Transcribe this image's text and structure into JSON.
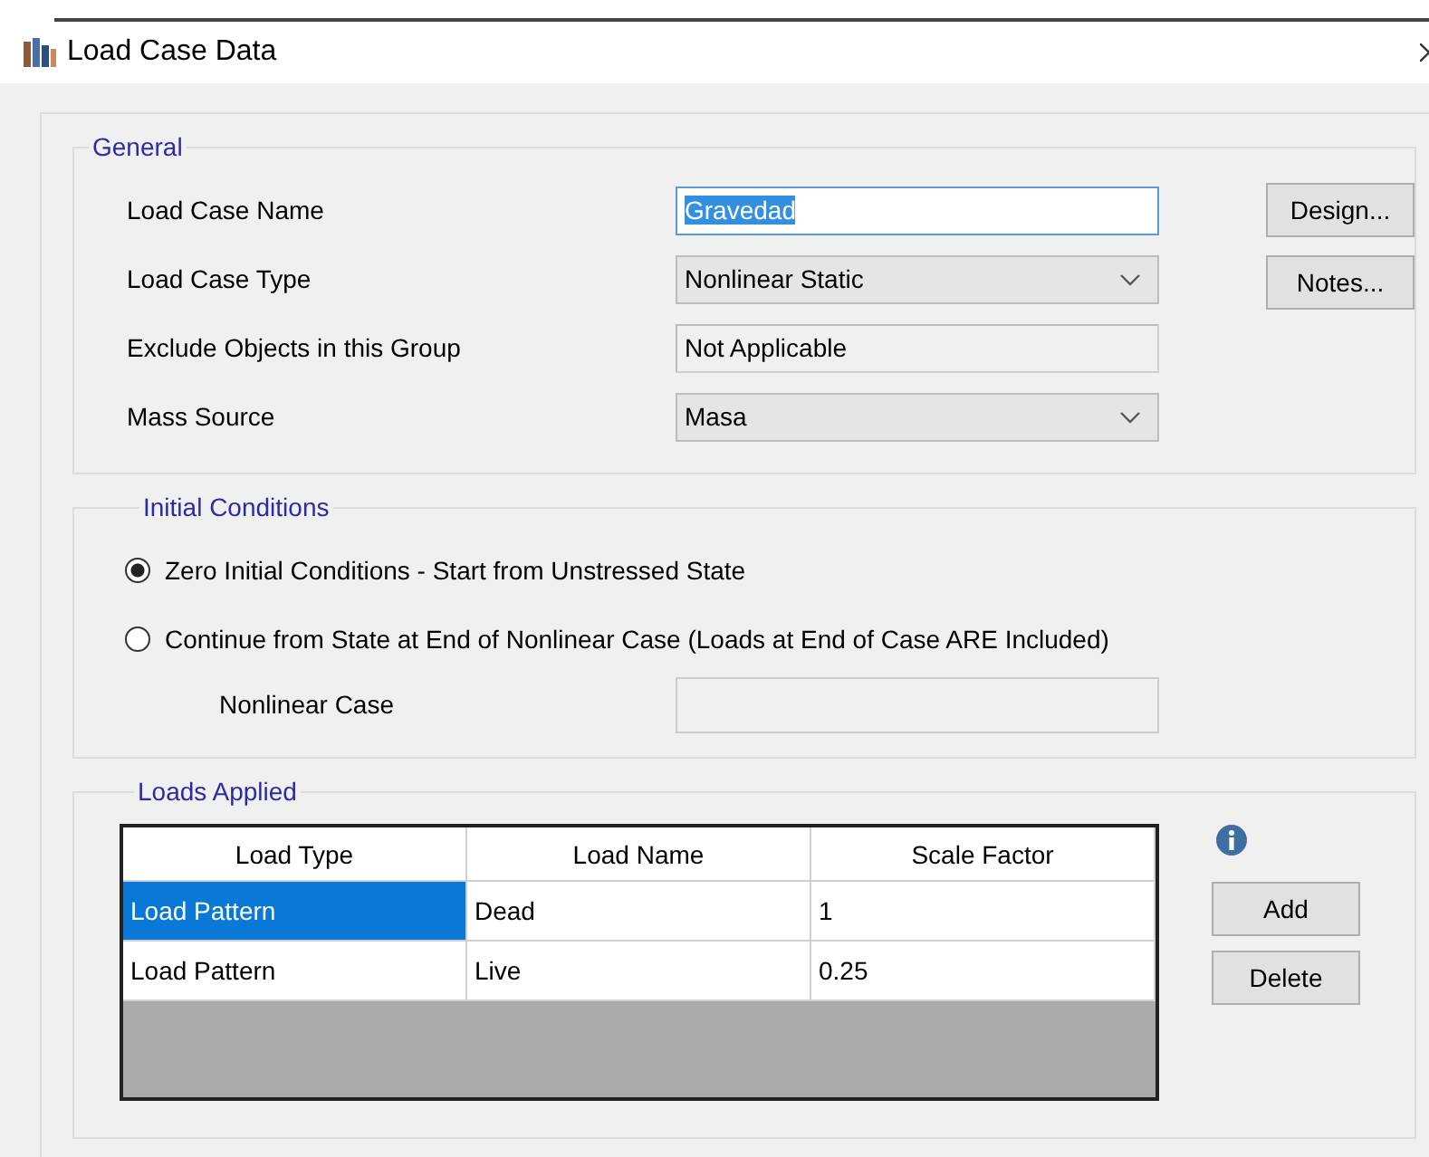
{
  "window": {
    "title": "Load Case Data"
  },
  "general": {
    "title": "General",
    "fields": [
      {
        "label": "Load Case Name",
        "kind": "text",
        "value": "Gravedad",
        "text_selected": true
      },
      {
        "label": "Load Case Type",
        "kind": "dropdown",
        "value": "Nonlinear Static"
      },
      {
        "label": "Exclude Objects in this Group",
        "kind": "readonly",
        "value": "Not Applicable"
      },
      {
        "label": "Mass Source",
        "kind": "dropdown",
        "value": "Masa"
      }
    ],
    "buttons": [
      "Design...",
      "Notes..."
    ]
  },
  "initial_conditions": {
    "title": "Initial Conditions",
    "options": [
      {
        "label": "Zero Initial Conditions - Start from Unstressed State",
        "selected": true
      },
      {
        "label": "Continue from State at End of Nonlinear Case  (Loads at End of Case ARE Included)",
        "selected": false
      }
    ],
    "nonlinear_case": {
      "label": "Nonlinear Case"
    }
  },
  "loads_applied": {
    "title": "Loads Applied",
    "columns": [
      "Load Type",
      "Load Name",
      "Scale Factor"
    ],
    "rows": [
      {
        "cells": [
          "Load Pattern",
          "Dead",
          "1"
        ],
        "selected": true
      },
      {
        "cells": [
          "Load Pattern",
          "Live",
          "0.25"
        ],
        "selected": false
      }
    ],
    "buttons": [
      "Add",
      "Delete"
    ]
  }
}
